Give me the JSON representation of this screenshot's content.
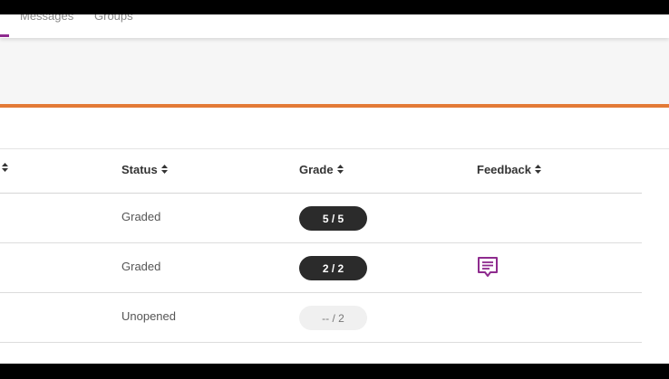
{
  "nav": {
    "tabs": [
      {
        "label": "Messages"
      },
      {
        "label": "Groups"
      }
    ]
  },
  "table": {
    "columns": [
      {
        "label": ""
      },
      {
        "label": "Status"
      },
      {
        "label": "Grade"
      },
      {
        "label": "Feedback"
      }
    ],
    "rows": [
      {
        "status": "Graded",
        "grade": "5 / 5",
        "grade_style": "dark",
        "feedback": false
      },
      {
        "status": "Graded",
        "grade": "2 / 2",
        "grade_style": "dark",
        "feedback": true
      },
      {
        "status": "Unopened",
        "grade": "-- / 2",
        "grade_style": "light",
        "feedback": false
      }
    ]
  },
  "colors": {
    "accent_purple": "#8e2b8e",
    "banner_orange": "#e37a36",
    "grade_pill_dark": "#2b2b2b"
  },
  "icons": {
    "sort": "sort-updown-icon",
    "feedback": "feedback-comment-icon"
  }
}
